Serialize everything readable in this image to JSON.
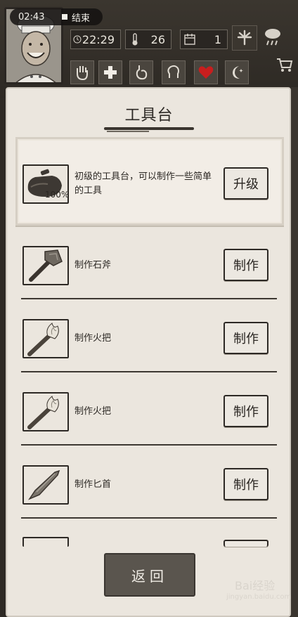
{
  "recording": {
    "time": "02:43",
    "end_label": "结束"
  },
  "stats": {
    "clock": "22:29",
    "temperature": "26",
    "day": "1"
  },
  "panel": {
    "title": "工具台"
  },
  "workbench": {
    "description": "初级的工具台，可以制作一些简单的工具",
    "percent": "100%",
    "upgrade_label": "升级"
  },
  "recipes": [
    {
      "label": "制作石斧",
      "button": "制作",
      "icon": "stone-axe-icon"
    },
    {
      "label": "制作火把",
      "button": "制作",
      "icon": "torch-icon"
    },
    {
      "label": "制作火把",
      "button": "制作",
      "icon": "torch-icon"
    },
    {
      "label": "制作匕首",
      "button": "制作",
      "icon": "dagger-icon"
    }
  ],
  "back_label": "返回",
  "watermark": {
    "brand": "Bai经验",
    "url": "jingyan.baidu.com"
  }
}
